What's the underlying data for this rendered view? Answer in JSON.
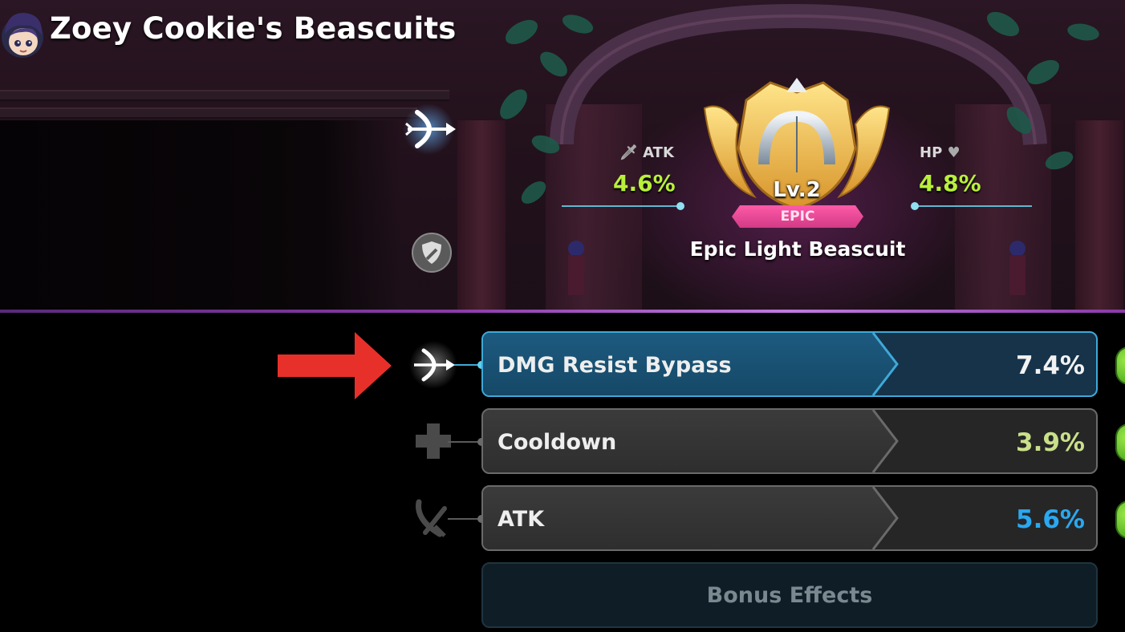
{
  "header": {
    "title": "Zoey Cookie's Beascuits"
  },
  "beascuit": {
    "level": "Lv.2",
    "rarity": "EPIC",
    "name": "Epic Light Beascuit",
    "atk": {
      "label": "ATK",
      "value": "4.6%"
    },
    "hp": {
      "label": "HP",
      "value": "4.8%"
    }
  },
  "substats": [
    {
      "label": "DMG Resist Bypass",
      "value": "7.4%",
      "value_color": "#f2f2f2",
      "selected": true,
      "icon": "bow-arrow-icon"
    },
    {
      "label": "Cooldown",
      "value": "3.9%",
      "value_color": "#c9e08a",
      "selected": false,
      "icon": "plus-icon"
    },
    {
      "label": "ATK",
      "value": "5.6%",
      "value_color": "#2aa8f0",
      "selected": false,
      "icon": "crossed-swords-icon"
    }
  ],
  "bonus_effects_label": "Bonus Effects",
  "colors": {
    "stat_value": "#b8f03a",
    "rarity_badge": "#e84a98",
    "selected_border": "#3fa9d8",
    "arrow": "#e8302a"
  }
}
